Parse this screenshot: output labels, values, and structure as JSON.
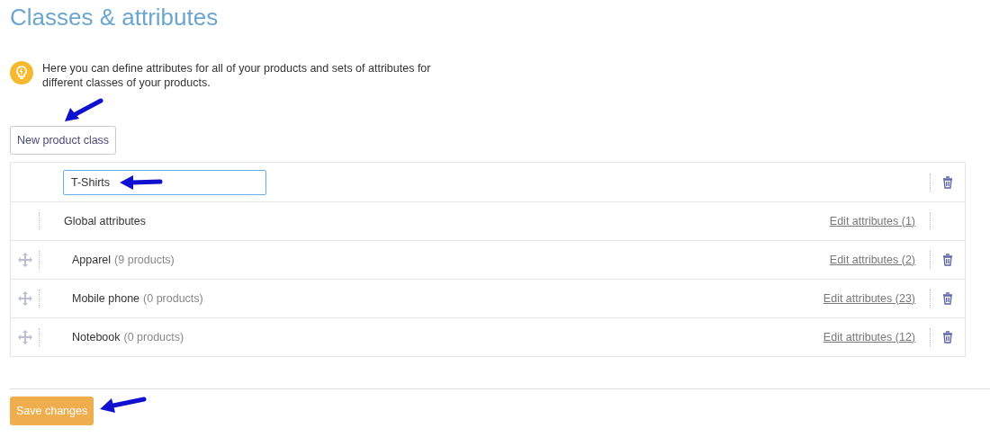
{
  "title": "Classes & attributes",
  "hint": "Here you can define attributes for all of your products and sets of attributes for different classes of your products.",
  "new_class_button": "New product class",
  "rows": [
    {
      "kind": "new",
      "value": "T-Shirts"
    },
    {
      "kind": "global",
      "name": "Global attributes",
      "link": "Edit attributes (1)"
    },
    {
      "kind": "class",
      "name": "Apparel",
      "count": "(9 products)",
      "link": "Edit attributes (2)"
    },
    {
      "kind": "class",
      "name": "Mobile phone",
      "count": "(0 products)",
      "link": "Edit attributes (23)"
    },
    {
      "kind": "class",
      "name": "Notebook",
      "count": "(0 products)",
      "link": "Edit attributes (12)"
    }
  ],
  "save_button": "Save changes"
}
